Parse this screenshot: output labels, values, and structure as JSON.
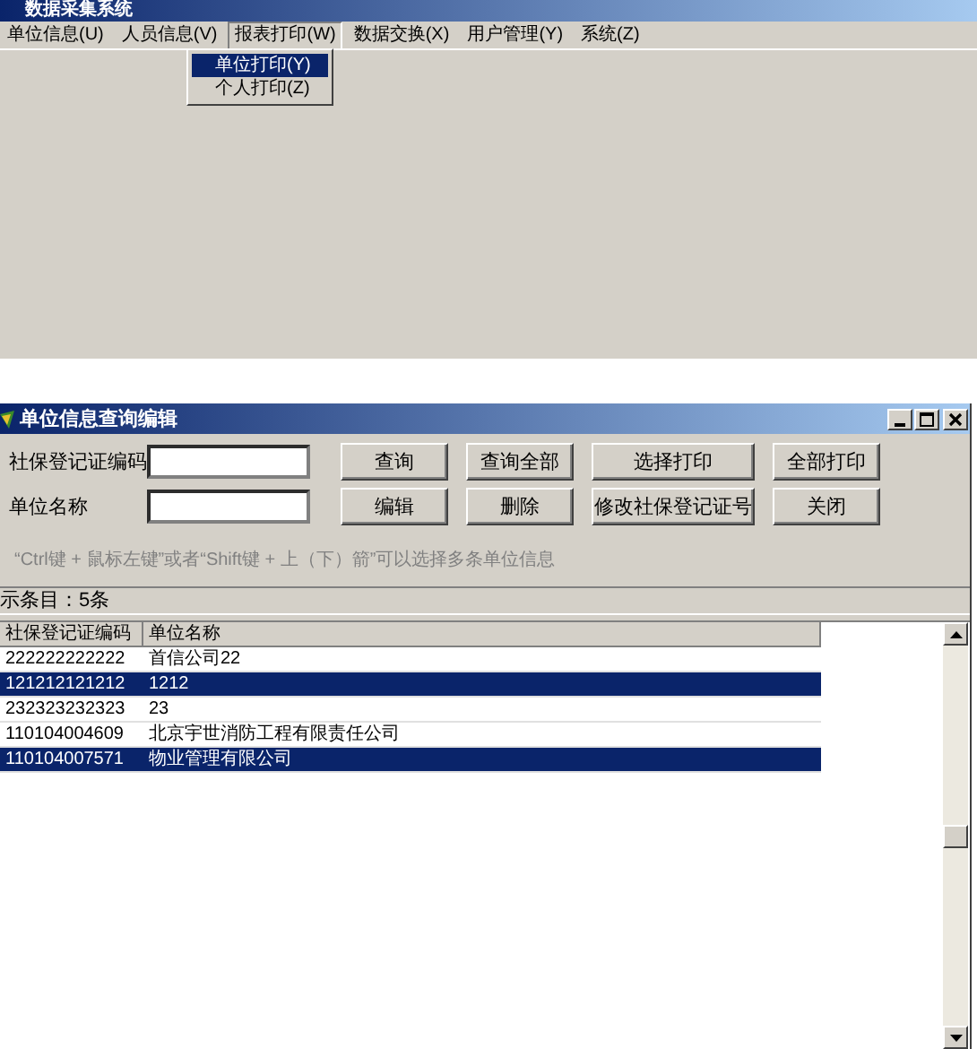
{
  "main_window": {
    "title": "数据采集系统"
  },
  "menu_bar": [
    {
      "label": "单位信息(U)",
      "selected": false
    },
    {
      "label": "人员信息(V)",
      "selected": false
    },
    {
      "label": "报表打印(W)",
      "selected": true
    },
    {
      "label": "数据交换(X)",
      "selected": false
    },
    {
      "label": "用户管理(Y)",
      "selected": false
    },
    {
      "label": "系统(Z)",
      "selected": false
    }
  ],
  "dropdown_menu": [
    {
      "label": "单位打印(Y)",
      "selected": true
    },
    {
      "label": "个人打印(Z)",
      "selected": false
    }
  ],
  "dialog": {
    "title": "单位信息查询编辑",
    "fields": [
      {
        "label": "社保登记证编码"
      },
      {
        "label": "单位名称"
      }
    ],
    "buttons": [
      [
        "查询",
        "查询全部",
        "选择打印",
        "全部打印"
      ],
      [
        "编辑",
        "删除",
        "修改社保登记证号",
        "关闭"
      ]
    ],
    "hint": "“Ctrl键 + 鼠标左键”或者“Shift键 + 上（下）箭”可以选择多条单位信息",
    "status": "示条目：5条",
    "table": {
      "columns": [
        "社保登记证编码",
        "单位名称"
      ],
      "rows": [
        {
          "cells": [
            "222222222222",
            "首信公司22"
          ],
          "selected": false
        },
        {
          "cells": [
            "121212121212",
            "1212"
          ],
          "selected": true
        },
        {
          "cells": [
            "232323232323",
            "23"
          ],
          "selected": false
        },
        {
          "cells": [
            "110104004609",
            "北京宇世消防工程有限责任公司"
          ],
          "selected": false
        },
        {
          "cells": [
            "110104007571",
            "物业管理有限公司"
          ],
          "selected": true
        }
      ]
    }
  }
}
